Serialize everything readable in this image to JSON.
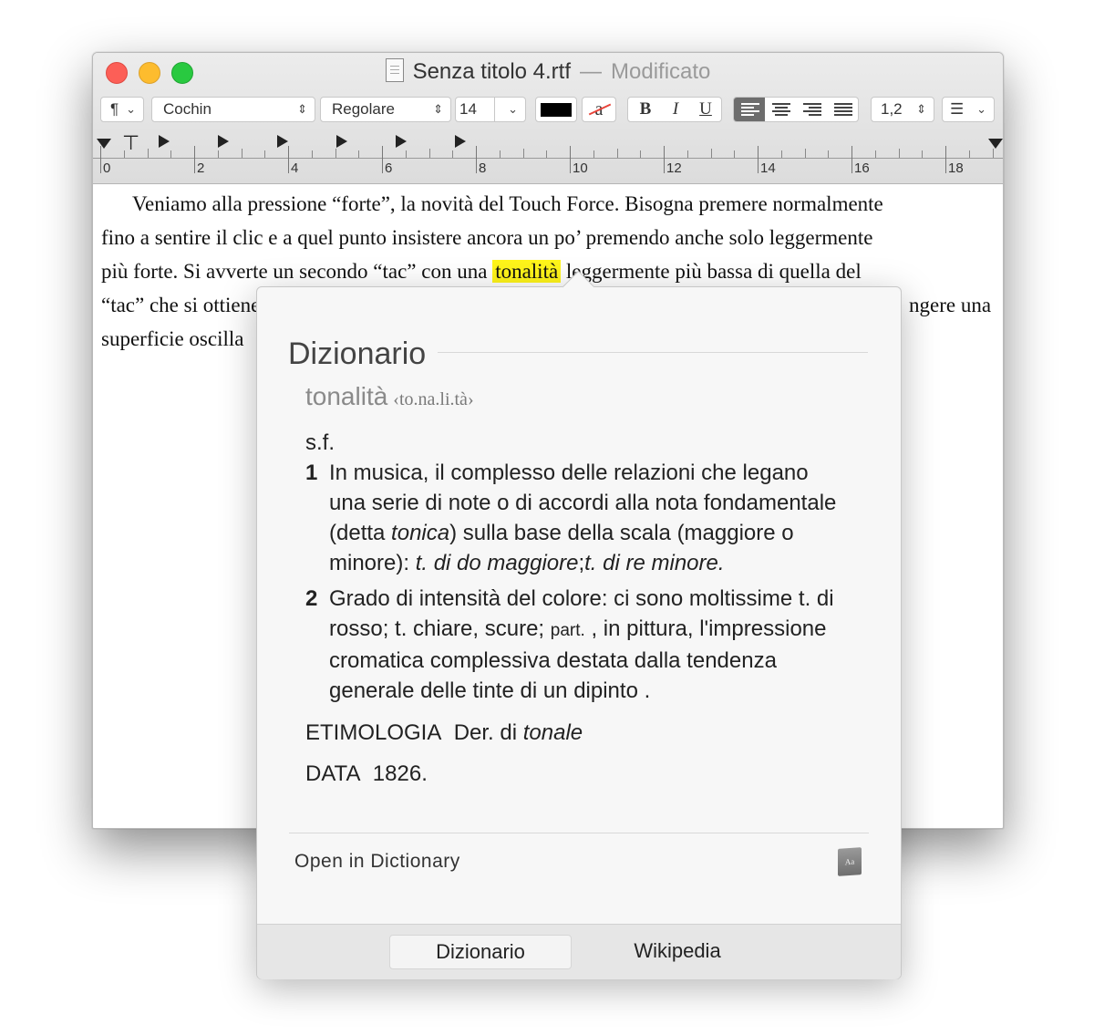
{
  "window": {
    "filename": "Senza titolo 4.rtf",
    "separator": "—",
    "status": "Modificato"
  },
  "toolbar": {
    "paragraph_style": "¶",
    "font_family": "Cochin",
    "font_style": "Regolare",
    "font_size": "14",
    "text_color": "#000000",
    "bold": "B",
    "italic": "I",
    "underline": "U",
    "line_spacing": "1,2",
    "background_glyph": "a"
  },
  "ruler": {
    "labels": [
      "0",
      "2",
      "4",
      "6",
      "8",
      "10",
      "12",
      "14",
      "16",
      "18"
    ]
  },
  "document": {
    "line1": "Veniamo alla pressione “forte”, la novità del Touch Force. Bisogna premere normalmente",
    "line2": "fino a sentire il clic e a quel punto insistere ancora un po’ premendo anche solo leggermente",
    "line3_before": "più forte. Si avverte un secondo “tac” con una ",
    "line3_highlight": "tonalità",
    "line3_after": " leggermente più bassa di quella del",
    "line4_start": "“tac” che si ottiene",
    "line4_end": "ngere una",
    "line5": "superficie oscilla",
    "highlight_color": "#fff51a"
  },
  "dictionary": {
    "heading": "Dizionario",
    "headword": "tonalità",
    "syllables": "‹to.na.li.tà›",
    "pos": "s.f.",
    "sense1": {
      "num": "1",
      "line1": "In musica, il complesso delle relazioni che legano",
      "line2": "una serie di note o di accordi alla nota fondamentale",
      "line3_a": "(detta ",
      "line3_em": "tonica",
      "line3_b": ") sulla base della scala (maggiore o",
      "line4_a": "minore): ",
      "line4_em1": "t. di do maggiore",
      "line4_b": ";",
      "line4_em2": "t. di re minore."
    },
    "sense2": {
      "num": "2",
      "line1": "Grado di intensità del colore: ci sono moltissime t. di",
      "line2_a": "rosso; t. chiare, scure; ",
      "line2_sm": "part.",
      "line2_b": " , in pittura, l'impressione",
      "line3": "cromatica complessiva destata dalla tendenza",
      "line4": "generale delle tinte di un dipinto ."
    },
    "etym_label": "ETIMOLOGIA",
    "etym_text": "Der. di ",
    "etym_em": "tonale",
    "date_label": "DATA",
    "date_value": "1826.",
    "open_link": "Open in Dictionary",
    "icon_text": "Aa",
    "tabs": [
      "Dizionario",
      "Wikipedia"
    ]
  }
}
